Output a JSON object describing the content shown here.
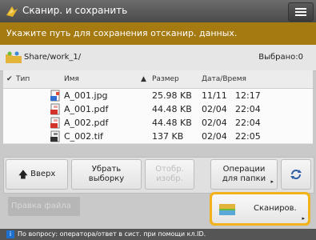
{
  "window": {
    "title": "Сканир. и сохранить"
  },
  "instruction": "Укажите путь для сохранения отсканир. данных.",
  "location": {
    "path": "Share/work_1/",
    "selected_label": "Выбрано:0"
  },
  "columns": {
    "type": "Тип",
    "name": "Имя",
    "size": "Размер",
    "datetime": "Дата/Время"
  },
  "files": [
    {
      "icon": "jpg-file-icon",
      "name": "A_001.jpg",
      "size": "25.98 KB",
      "date": "11/11",
      "time": "12:17"
    },
    {
      "icon": "pdf-file-icon",
      "name": "A_001.pdf",
      "size": "44.48 KB",
      "date": "02/04",
      "time": "22:04"
    },
    {
      "icon": "pdf-file-icon",
      "name": "A_002.pdf",
      "size": "44.48 KB",
      "date": "02/04",
      "time": "22:04"
    },
    {
      "icon": "tif-file-icon",
      "name": "C_002.tif",
      "size": "137 KB",
      "date": "02/04",
      "time": "22:05"
    }
  ],
  "toolbar": {
    "up": "Вверх",
    "clear_line1": "Убрать",
    "clear_line2": "выборку",
    "display_line1": "Отобр.",
    "display_line2": "изобр.",
    "folder_ops_line1": "Операции",
    "folder_ops_line2": "для папки"
  },
  "bottom": {
    "preview": "Правка файла",
    "scan": "Сканиров."
  },
  "status": {
    "text": "По вопросу: оператора/ответ в сист. при помощи кл.ID."
  },
  "colors": {
    "accent": "#f1b21b",
    "instruction_bg": "#a57a10"
  }
}
